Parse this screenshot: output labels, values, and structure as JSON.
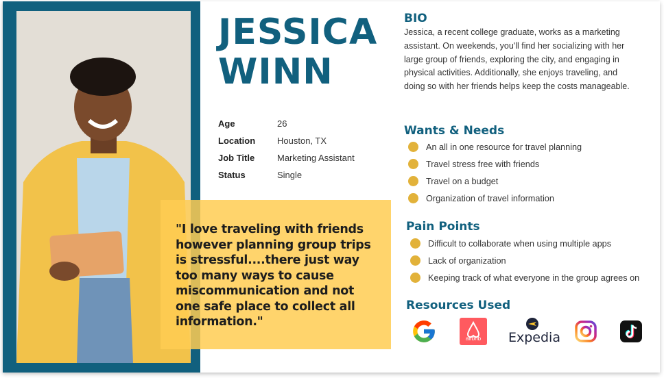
{
  "persona": {
    "first_name": "JESSICA",
    "last_name": "WINN"
  },
  "facts": [
    {
      "label": "Age",
      "value": "26"
    },
    {
      "label": "Location",
      "value": "Houston, TX"
    },
    {
      "label": "Job Title",
      "value": "Marketing Assistant"
    },
    {
      "label": "Status",
      "value": "Single"
    }
  ],
  "quote": "\"I love traveling with friends however planning group trips is stressful....there just way too many ways to cause miscommunication and not one safe place to collect all information.\"",
  "bio": {
    "title": "BIO",
    "text": "Jessica, a recent college graduate, works as a marketing assistant. On weekends, you'll find her socializing with her large group of friends, exploring the city, and engaging in physical activities. Additionally, she enjoys traveling, and doing so with her friends helps keep the costs manageable."
  },
  "wants_needs": {
    "title": "Wants & Needs",
    "items": [
      "An all in one resource for travel planning",
      "Travel stress free with friends",
      "Travel on a budget",
      "Organization of travel information"
    ]
  },
  "pain_points": {
    "title": "Pain Points",
    "items": [
      "Difficult to collaborate when using multiple apps",
      "Lack of organization",
      "Keeping track of what everyone in the group agrees on"
    ]
  },
  "resources": {
    "title": "Resources Used",
    "logos": [
      "google-logo",
      "airbnb-logo",
      "expedia-logo",
      "instagram-logo",
      "tiktok-logo"
    ],
    "airbnb_text": "airbnb",
    "expedia_text": "Expedia"
  },
  "colors": {
    "brand_teal": "#11607e",
    "quote_yellow": "#ffcc52",
    "bullet_gold": "#e2b23a"
  }
}
